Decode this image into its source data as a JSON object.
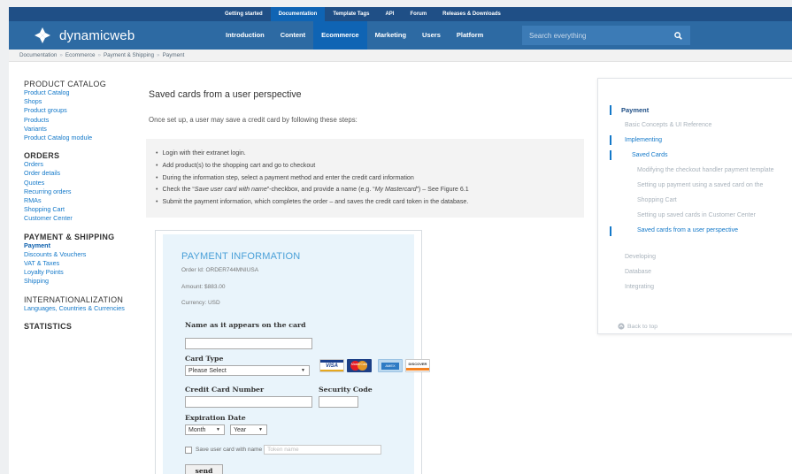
{
  "topnav": {
    "links": [
      "Getting started",
      "Documentation",
      "Template Tags",
      "API",
      "Forum",
      "Releases & Downloads"
    ],
    "active_index": 1
  },
  "mainnav": {
    "logo": "dynamicweb",
    "links": [
      "Introduction",
      "Content",
      "Ecommerce",
      "Marketing",
      "Users",
      "Platform"
    ],
    "active_index": 2,
    "search_placeholder": "Search everything"
  },
  "breadcrumb": [
    "Documentation",
    "Ecommerce",
    "Payment & Shipping",
    "Payment"
  ],
  "sidebar": {
    "product_catalog": {
      "heading": "PRODUCT CATALOG",
      "links": [
        "Product Catalog",
        "Shops",
        "Product groups",
        "Products",
        "Variants",
        "Product Catalog module"
      ]
    },
    "orders": {
      "heading": "ORDERS",
      "links": [
        "Orders",
        "Order details",
        "Quotes",
        "Recurring orders",
        "RMAs",
        "Shopping Cart",
        "Customer Center"
      ]
    },
    "payment_shipping": {
      "heading": "PAYMENT & SHIPPING",
      "links": [
        "Payment",
        "Discounts & Vouchers",
        "VAT & Taxes",
        "Loyalty Points",
        "Shipping"
      ]
    },
    "internationalization": {
      "heading": "INTERNATIONALIZATION",
      "links": [
        "Languages, Countries & Currencies"
      ]
    },
    "statistics": {
      "heading": "STATISTICS"
    }
  },
  "content": {
    "title": "Saved cards from a user perspective",
    "intro": "Once set up, a user may save a credit card by following these steps:",
    "steps": [
      "Login with their extranet login.",
      "Add product(s) to the shopping cart and go to checkout",
      "During the information step, select a payment method and enter the credit card information"
    ],
    "step4": {
      "pre": "Check the “",
      "em1": "Save user card with name",
      "mid": "”-checkbox, and provide a name (e.g. “",
      "em2": "My Mastercard",
      "post": "”) – See Figure 6.1"
    },
    "step5": "Submit the payment information, which completes the order – and saves the credit card token in the database."
  },
  "payment_form": {
    "heading": "PAYMENT INFORMATION",
    "order_id": "Order Id: ORDER744MNIUSA",
    "amount": "Amount: $883.00",
    "currency": "Currency: USD",
    "name_label": "Name as it appears on the card",
    "card_type_label": "Card Type",
    "card_type_value": "Please Select",
    "card_logos": [
      "VISA",
      "MasterCard",
      "AMEX",
      "DISCOVER"
    ],
    "card_number_label": "Credit Card Number",
    "security_code_label": "Security Code",
    "expiration_label": "Expiration Date",
    "month_value": "Month",
    "year_value": "Year",
    "save_label": "Save user card with name",
    "token_placeholder": "Token name",
    "send_label": "send"
  },
  "toc": {
    "heading": "Payment",
    "items": [
      "Basic Concepts & UI Reference",
      "Implementing",
      "Saved Cards",
      "Modifying the checkout handler payment template",
      "Setting up payment using a saved card on the",
      "Shopping Cart",
      "Setting up saved cards in Customer Center",
      "Saved cards from a user perspective",
      "Developing",
      "Database",
      "Integrating"
    ],
    "back_to_top": "Back to top"
  },
  "colors": {
    "header_dark": "#1f4f86",
    "header": "#2d6aa3",
    "active": "#0f64b4",
    "link": "#1479c9",
    "accent": "#4aa0d8"
  }
}
